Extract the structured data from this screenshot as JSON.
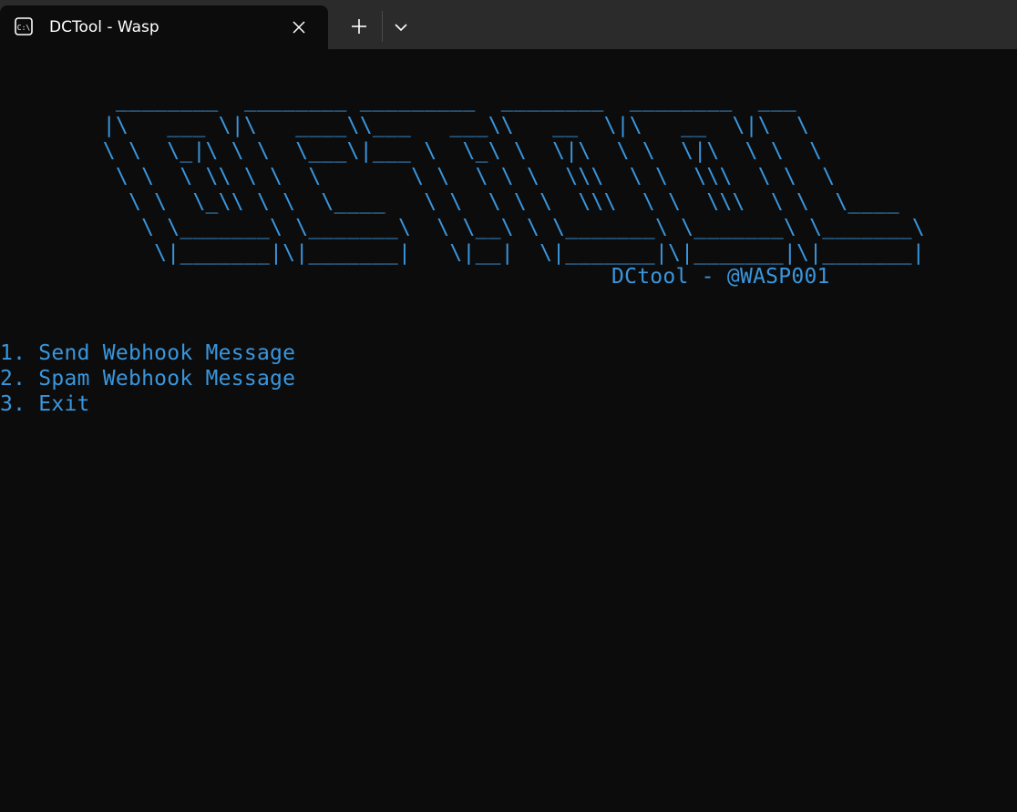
{
  "tab": {
    "title": "DCTool - Wasp",
    "icon": "terminal-icon"
  },
  "tabbar": {
    "close_icon": "close-icon",
    "new_tab_icon": "plus-icon",
    "dropdown_icon": "chevron-down-icon"
  },
  "banner": {
    "art": "         ________  ________ _________  ________  ________  ___\n        |\\   ___ \\|\\   ____\\\\___   ___\\\\   __  \\|\\   __  \\|\\  \\\n        \\ \\  \\_|\\ \\ \\  \\___\\|___ \\  \\_\\ \\  \\|\\  \\ \\  \\|\\  \\ \\  \\\n         \\ \\  \\ \\\\ \\ \\  \\       \\ \\  \\ \\ \\  \\\\\\  \\ \\  \\\\\\  \\ \\  \\\n          \\ \\  \\_\\\\ \\ \\  \\____   \\ \\  \\ \\ \\  \\\\\\  \\ \\  \\\\\\  \\ \\  \\____\n           \\ \\_______\\ \\_______\\  \\ \\__\\ \\ \\_______\\ \\_______\\ \\_______\\\n            \\|_______|\\|_______|   \\|__|  \\|_______|\\|_______|\\|_______|",
    "credit": "DCtool - @WASP001"
  },
  "menu": {
    "items": [
      {
        "label": "1. Send Webhook Message"
      },
      {
        "label": "2. Spam Webhook Message"
      },
      {
        "label": "3. Exit"
      }
    ]
  },
  "colors": {
    "terminal_bg": "#0c0c0c",
    "tabbar_bg": "#2b2b2b",
    "text_blue": "#3a96dd"
  }
}
